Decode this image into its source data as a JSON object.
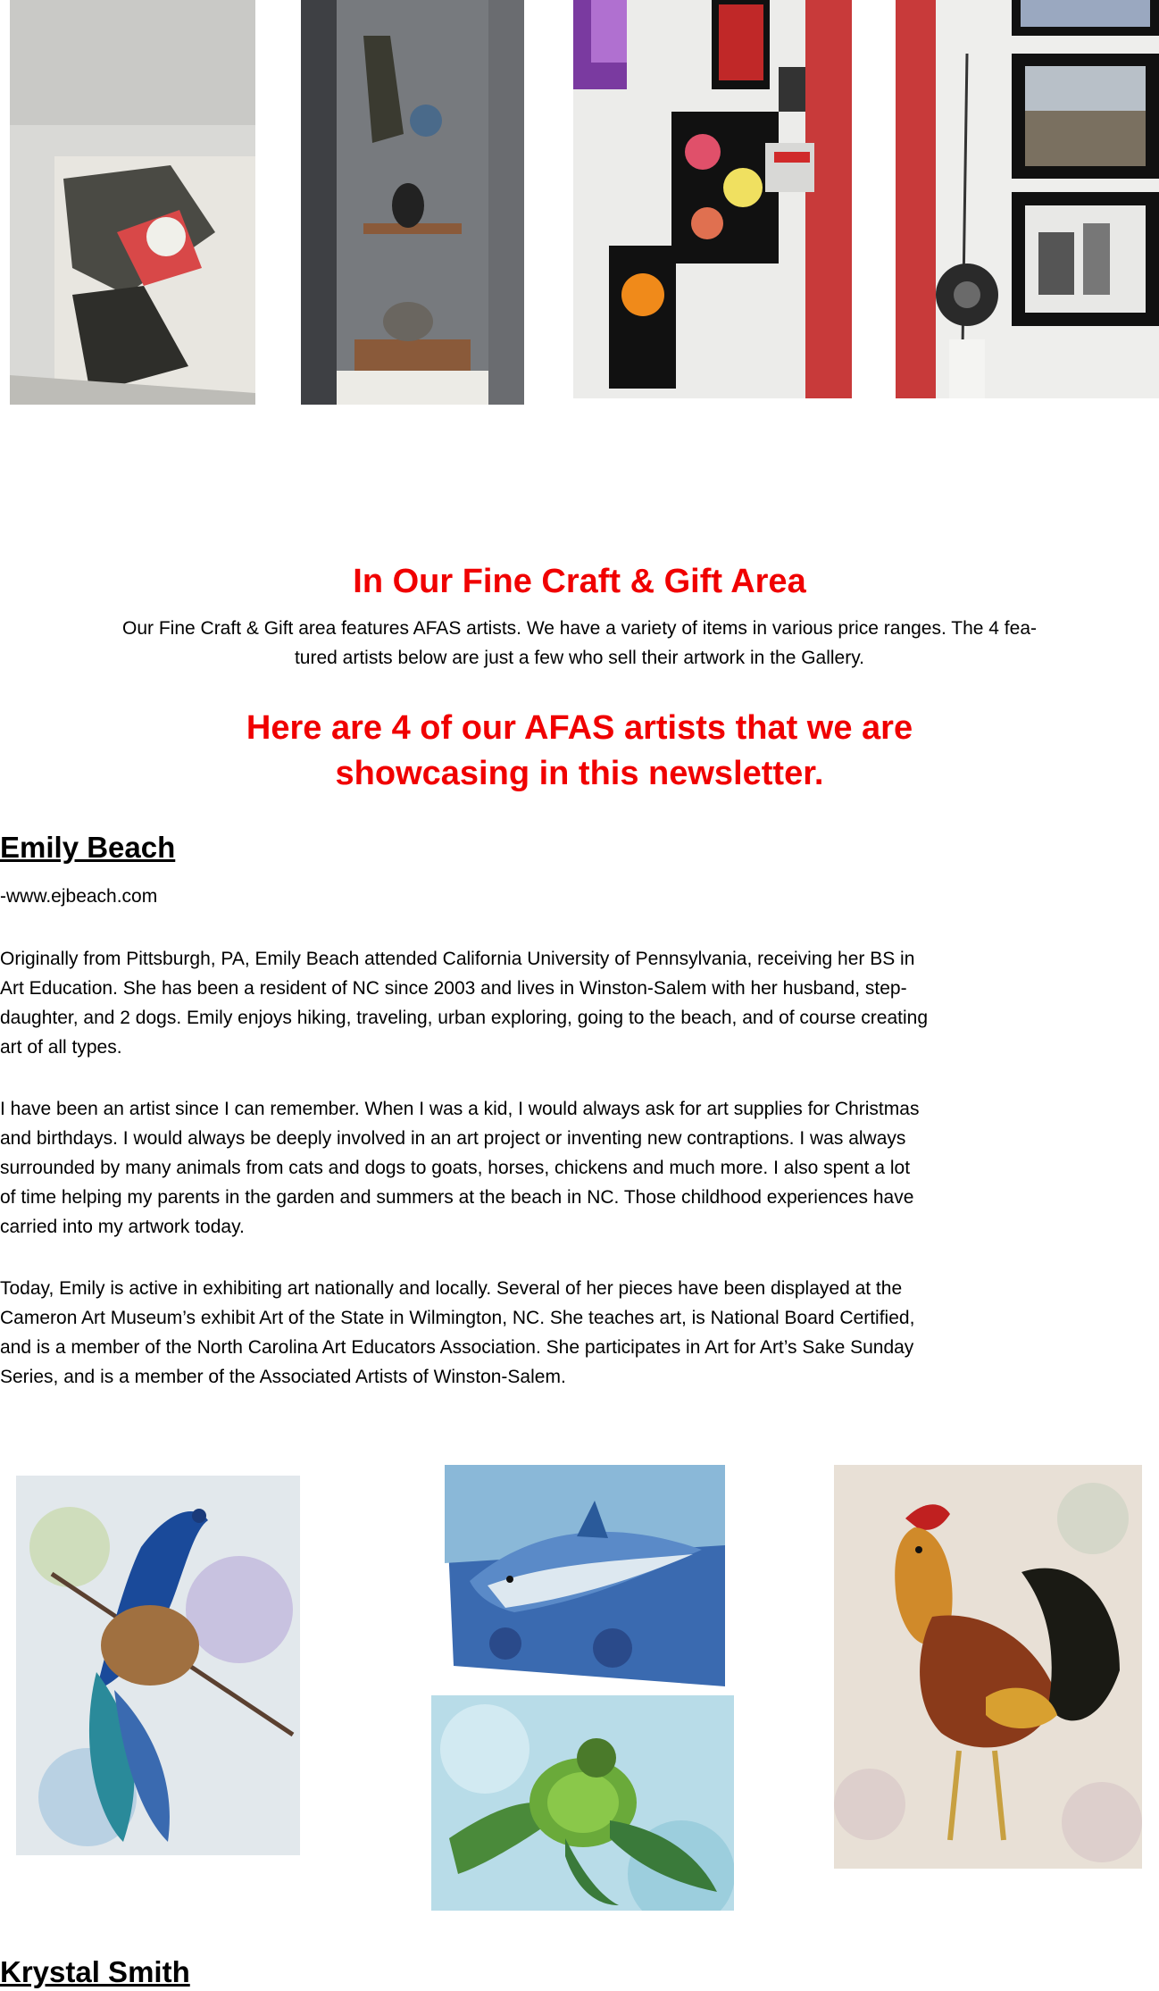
{
  "fine_craft": {
    "title": "In Our Fine Craft & Gift Area",
    "intro_line1": "Our Fine Craft & Gift area features AFAS artists.  We have a variety of items in various price ranges.  The 4 fea-",
    "intro_line2": "tured artists below are just a few who sell their artwork in the Gallery."
  },
  "showcase": {
    "line1": "Here are 4 of our AFAS artists that we are",
    "line2": "showcasing in this newsletter."
  },
  "emily": {
    "name": "Emily Beach",
    "website": "-www.ejbeach.com",
    "paragraph1": {
      "l1": "Originally from Pittsburgh, PA, Emily Beach attended California University of Pennsylvania, receiving her BS in",
      "l2": "Art Education. She has been a resident of NC since 2003 and lives in Winston-Salem with her husband, step-",
      "l3": "daughter, and 2 dogs. Emily enjoys hiking, traveling, urban exploring, going to the beach, and of course creating",
      "l4": "art of all types."
    },
    "paragraph2": {
      "l1": "I have been an artist since I can remember. When I was a kid, I would always ask for art supplies for Christmas",
      "l2": "and birthdays. I would always be deeply involved in an art project or inventing new contraptions. I was always",
      "l3": "surrounded by many animals from cats and dogs to goats, horses, chickens and much more. I also spent a lot",
      "l4": "of time helping my parents in the garden and summers at the beach in NC. Those childhood experiences have",
      "l5": "carried into my artwork today."
    },
    "paragraph3": {
      "l1": "Today, Emily is active in exhibiting art nationally and locally. Several of her pieces have been displayed at the",
      "l2": "Cameron Art Museum’s exhibit Art of the State in Wilmington, NC. She teaches art, is National Board Certified,",
      "l3": "and is a member of the North Carolina Art Educators Association. She participates in Art for Art’s Sake Sunday",
      "l4": "Series, and is a member of the Associated Artists of Winston-Salem."
    }
  },
  "krystal": {
    "name": "Krystal Smith"
  },
  "colors": {
    "heading_red": "#f00000",
    "text": "#000000"
  }
}
